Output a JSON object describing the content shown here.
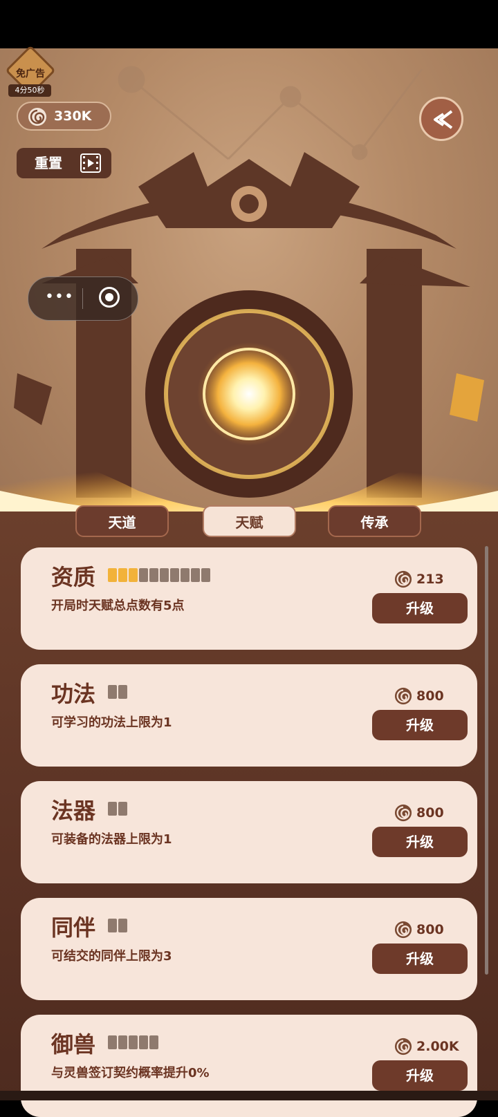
{
  "ad_badge": {
    "title": "免广告",
    "timer": "4分50秒"
  },
  "currency": {
    "amount": "330K",
    "icon": "spiral-coin-icon"
  },
  "reset": {
    "label": "重置",
    "icon": "video-icon"
  },
  "back": {
    "icon": "double-chevron-left-icon"
  },
  "capsule": {
    "more": "•••",
    "close_icon": "target-circle-icon"
  },
  "tabs": [
    {
      "label": "天道",
      "active": false
    },
    {
      "label": "天赋",
      "active": true
    },
    {
      "label": "传承",
      "active": false
    }
  ],
  "talents": [
    {
      "name": "资质",
      "level": 3,
      "max": 10,
      "desc": "开局时天赋总点数有5点",
      "cost": "213",
      "button": "升级"
    },
    {
      "name": "功法",
      "level": 0,
      "max": 2,
      "desc": "可学习的功法上限为1",
      "cost": "800",
      "button": "升级"
    },
    {
      "name": "法器",
      "level": 0,
      "max": 2,
      "desc": "可装备的法器上限为1",
      "cost": "800",
      "button": "升级"
    },
    {
      "name": "同伴",
      "level": 0,
      "max": 2,
      "desc": "可结交的同伴上限为3",
      "cost": "800",
      "button": "升级"
    },
    {
      "name": "御兽",
      "level": 0,
      "max": 5,
      "desc": "与灵兽签订契约概率提升0%",
      "cost": "2.00K",
      "button": "升级"
    }
  ],
  "colors": {
    "accent": "#6e3a2a",
    "card": "#f7e5da",
    "level_on": "#f2b23a",
    "level_off": "#8f7a6e"
  }
}
